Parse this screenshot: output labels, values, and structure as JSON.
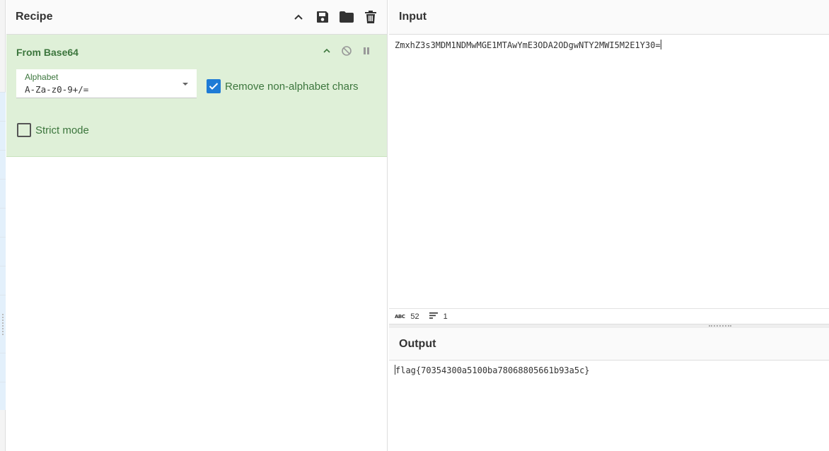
{
  "recipe": {
    "title": "Recipe",
    "icons": [
      "chevron-up-icon",
      "save-icon",
      "folder-icon",
      "trash-icon"
    ],
    "operation": {
      "name": "From Base64",
      "alphabet_label": "Alphabet",
      "alphabet_value": "A-Za-z0-9+/=",
      "remove_non_alphabet_label": "Remove non-alphabet chars",
      "remove_non_alphabet_checked": true,
      "strict_mode_label": "Strict mode",
      "strict_mode_checked": false
    }
  },
  "input": {
    "title": "Input",
    "text": "ZmxhZ3s3MDM1NDMwMGE1MTAwYmE3ODA2ODgwNTY2MWI5M2E1Y30=",
    "length": "52",
    "lines": "1"
  },
  "output": {
    "title": "Output",
    "text": "flag{70354300a5100ba78068805661b93a5c}"
  },
  "colors": {
    "op_bg": "#dff0d8",
    "op_text": "#3c763d",
    "checkbox": "#1e7bd6"
  }
}
